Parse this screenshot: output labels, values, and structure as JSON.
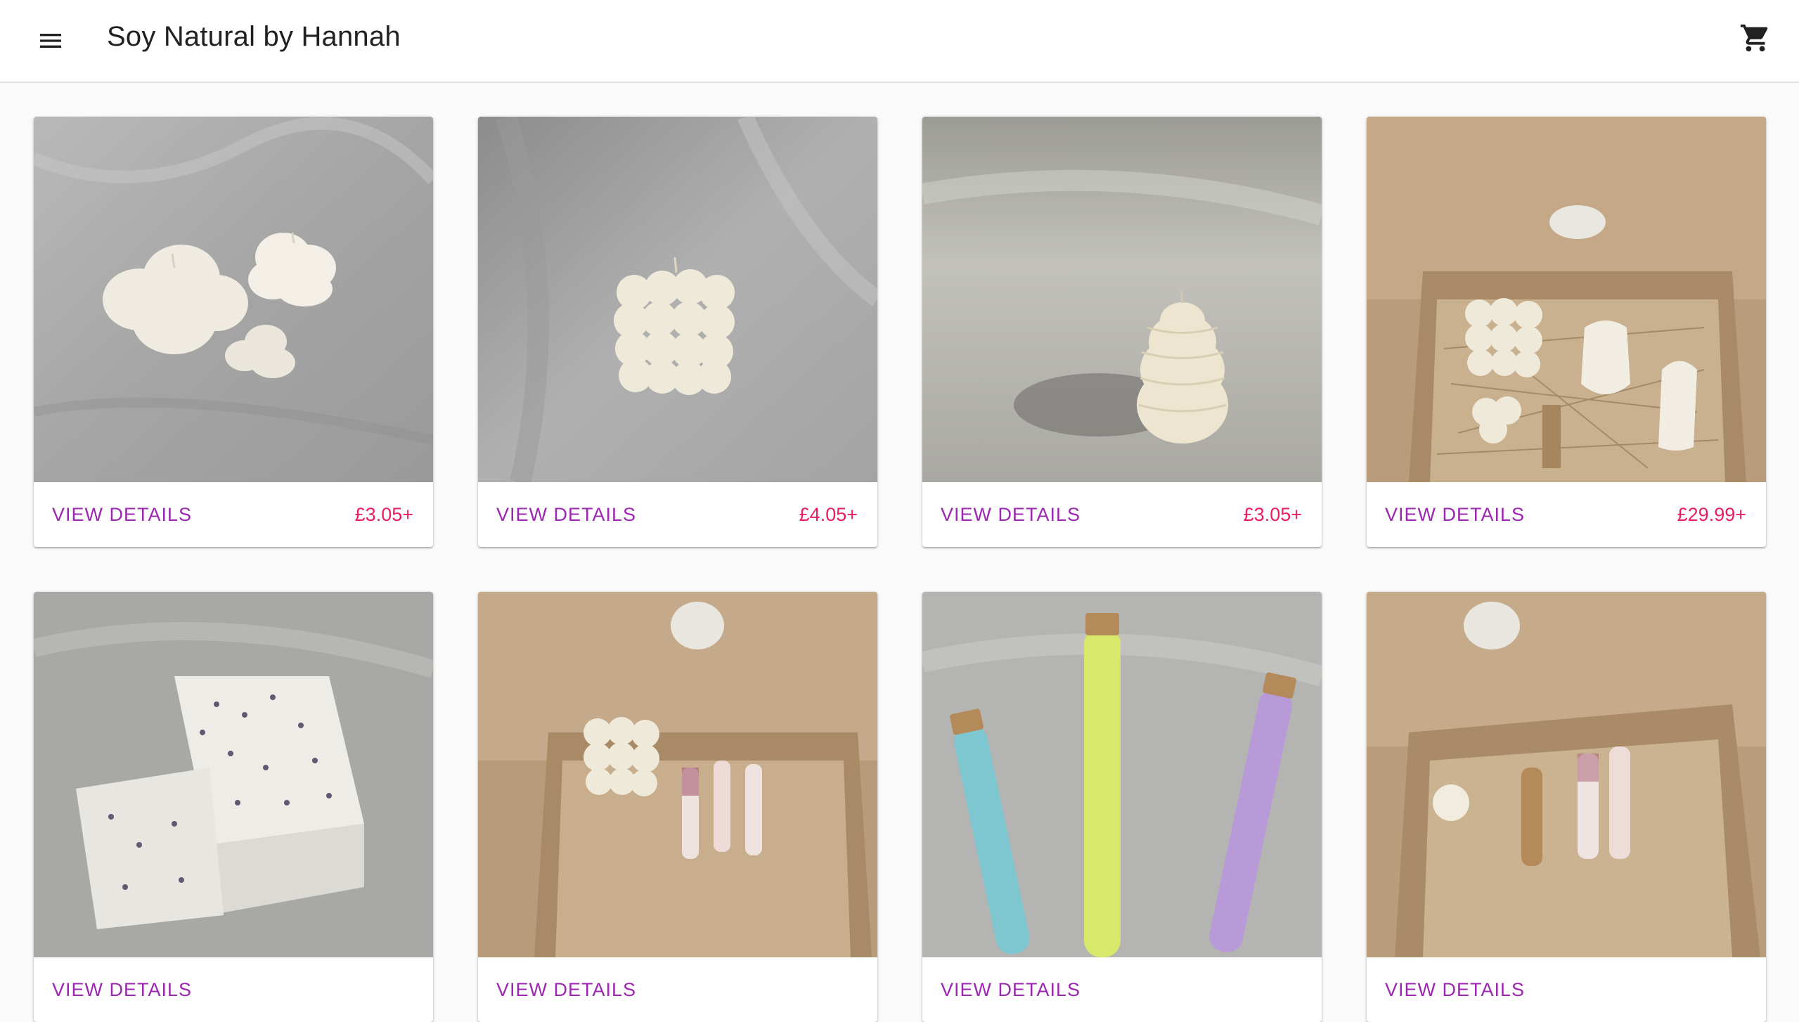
{
  "header": {
    "title": "Soy Natural by Hannah",
    "menu_icon": "hamburger-menu-icon",
    "cart_icon": "shopping-cart-icon"
  },
  "colors": {
    "view_details": "#9c27b0",
    "price": "#e91e63",
    "title": "#212121"
  },
  "products": [
    {
      "button": "VIEW DETAILS",
      "price": "£3.05+"
    },
    {
      "button": "VIEW DETAILS",
      "price": "£4.05+"
    },
    {
      "button": "VIEW DETAILS",
      "price": "£3.05+"
    },
    {
      "button": "VIEW DETAILS",
      "price": "£29.99+"
    },
    {
      "button": "VIEW DETAILS",
      "price": ""
    },
    {
      "button": "VIEW DETAILS",
      "price": ""
    },
    {
      "button": "VIEW DETAILS",
      "price": ""
    },
    {
      "button": "VIEW DETAILS",
      "price": ""
    }
  ]
}
